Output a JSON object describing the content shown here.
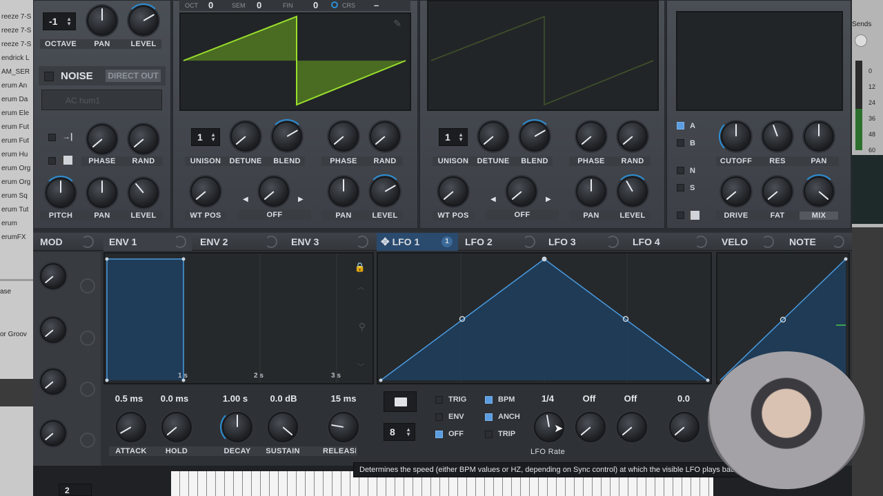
{
  "browser": {
    "items": [
      "reeze 7-S",
      "reeze 7-S",
      "reeze 7-S",
      "endrick L",
      "AM_SER",
      "erum An",
      "erum Da",
      "erum Ele",
      "erum Fut",
      "erum Fut",
      "erum Hu",
      "erum Org",
      "erum Org",
      "erum Sq",
      "erum Tut",
      "erum",
      "erumFX"
    ],
    "lower": [
      "ase",
      "or Groov"
    ]
  },
  "osc_a": {
    "octave_value": "-1",
    "octave_label": "OCTAVE",
    "pan_label": "PAN",
    "level_label": "LEVEL",
    "oct_label": "OCT",
    "oct_value": "0",
    "sem_label": "SEM",
    "sem_value": "0",
    "fin_label": "FIN",
    "fin_value": "0",
    "crs_label": "CRS",
    "crs_value": "–",
    "unison_value": "1",
    "unison_label": "UNISON",
    "detune_label": "DETUNE",
    "blend_label": "BLEND",
    "phase_label": "PHASE",
    "rand_label": "RAND",
    "wtpos_label": "WT POS",
    "warp_value": "OFF",
    "pan2_label": "PAN",
    "level2_label": "LEVEL"
  },
  "osc_b": {
    "unison_value": "1",
    "unison_label": "UNISON",
    "detune_label": "DETUNE",
    "blend_label": "BLEND",
    "phase_label": "PHASE",
    "rand_label": "RAND",
    "wtpos_label": "WT POS",
    "warp_value": "OFF",
    "pan_label": "PAN",
    "level_label": "LEVEL"
  },
  "noise": {
    "title": "NOISE",
    "direct_out": "DIRECT OUT",
    "sample": "AC hum1",
    "phase_label": "PHASE",
    "rand_label": "RAND",
    "pitch_label": "PITCH",
    "pan_label": "PAN",
    "level_label": "LEVEL"
  },
  "filter": {
    "route_a": "A",
    "route_b": "B",
    "route_n": "N",
    "route_s": "S",
    "cutoff_label": "CUTOFF",
    "res_label": "RES",
    "pan_label": "PAN",
    "drive_label": "DRIVE",
    "fat_label": "FAT",
    "mix_label": "MIX",
    "sends": "Sends",
    "meter_ticks": [
      "0",
      "12",
      "24",
      "36",
      "48",
      "60"
    ]
  },
  "tabs": {
    "mod": "MOD",
    "env1": "ENV 1",
    "env2": "ENV 2",
    "env3": "ENV 3",
    "lfo1": "LFO 1",
    "lfo1_count": "1",
    "lfo2": "LFO 2",
    "lfo3": "LFO 3",
    "lfo4": "LFO 4",
    "velo": "VELO",
    "note": "NOTE"
  },
  "env": {
    "attack_value": "0.5 ms",
    "hold_value": "0.0 ms",
    "decay_value": "1.00 s",
    "sustain_value": "0.0 dB",
    "release_value": "15 ms",
    "attack_label": "ATTACK",
    "hold_label": "HOLD",
    "decay_label": "DECAY",
    "sustain_label": "SUSTAIN",
    "release_label": "RELEASE",
    "time_marks": [
      "1 s",
      "2 s",
      "3 s"
    ]
  },
  "lfo": {
    "grid_value": "8",
    "trig_label": "TRIG",
    "env_label": "ENV",
    "off_label": "OFF",
    "bpm_label": "BPM",
    "anch_label": "ANCH",
    "trip_label": "TRIP",
    "rate_value": "1/4",
    "rise_value": "Off",
    "delay_value": "Off",
    "smooth_value": "0.0",
    "rate_label": "LFO Rate"
  },
  "tooltip": "Determines the speed (either BPM values or HZ, depending on Sync control) at which the visible LFO plays back",
  "bottom": {
    "voices_value": "2"
  },
  "colors": {
    "accent": "#2c8fd6",
    "wave": "#8fd62a",
    "lfo_line": "#4a9be0"
  }
}
